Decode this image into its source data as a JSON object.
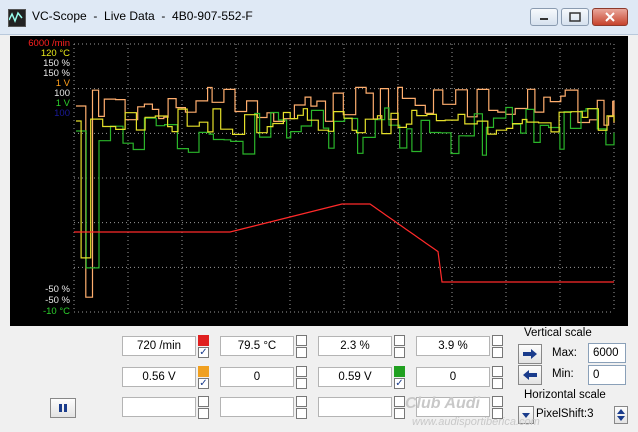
{
  "window": {
    "title": "VC-Scope  -  Live Data  -  4B0-907-552-F",
    "minimize_label": "minimize",
    "maximize_label": "maximize",
    "close_label": "close"
  },
  "scope": {
    "top_labels": [
      {
        "text": "6000 /min",
        "color": "#ff2020"
      },
      {
        "text": "120 °C",
        "color": "#e8e81a"
      },
      {
        "text": "150 %",
        "color": "#e8e8e8"
      },
      {
        "text": "150 %",
        "color": "#e8e8e8"
      },
      {
        "text": "1 V",
        "color": "#ff9f1c"
      },
      {
        "text": "100",
        "color": "#e8e8e8"
      },
      {
        "text": "1 V",
        "color": "#2ccf2c"
      },
      {
        "text": "100",
        "color": "#1a1a9a"
      }
    ],
    "bottom_labels": [
      {
        "text": "-50 %",
        "color": "#e8e8e8"
      },
      {
        "text": "-50 %",
        "color": "#e8e8e8"
      },
      {
        "text": "-10 °C",
        "color": "#2ccf2c"
      }
    ],
    "trace_colors": {
      "rpm": "#ff2a2a",
      "temp": "#e5e02a",
      "voltage": "#ffae6e",
      "green": "#2ab52a"
    }
  },
  "channels": {
    "row1": [
      {
        "value": "720 /min",
        "swatch": "#e02020",
        "checked": true
      },
      {
        "value": "79.5 °C",
        "swatch": null,
        "checked": false
      },
      {
        "value": "2.3 %",
        "swatch": null,
        "checked": false
      },
      {
        "value": "3.9 %",
        "swatch": null,
        "checked": false
      }
    ],
    "row2": [
      {
        "value": "0.56 V",
        "swatch": "#f0a020",
        "checked": true
      },
      {
        "value": "0",
        "swatch": null,
        "checked": false
      },
      {
        "value": "0.59 V",
        "swatch": "#20a020",
        "checked": true
      },
      {
        "value": "0",
        "swatch": null,
        "checked": false
      }
    ],
    "row3": [
      {
        "value": "",
        "checked": false
      },
      {
        "value": "",
        "checked": false
      },
      {
        "value": "",
        "checked": false
      },
      {
        "value": "",
        "checked": false
      }
    ]
  },
  "vertical_scale": {
    "label": "Vertical scale",
    "max_label": "Max:",
    "max_value": "6000",
    "min_label": "Min:",
    "min_value": "0"
  },
  "horizontal_scale": {
    "label": "Horizontal scale",
    "pixelshift": "PixelShift:3"
  },
  "check_mark": "✓",
  "pause_icon": "pause-icon",
  "watermark": {
    "line1": "Club Audi",
    "line2": "www.audisportiberica.com"
  }
}
